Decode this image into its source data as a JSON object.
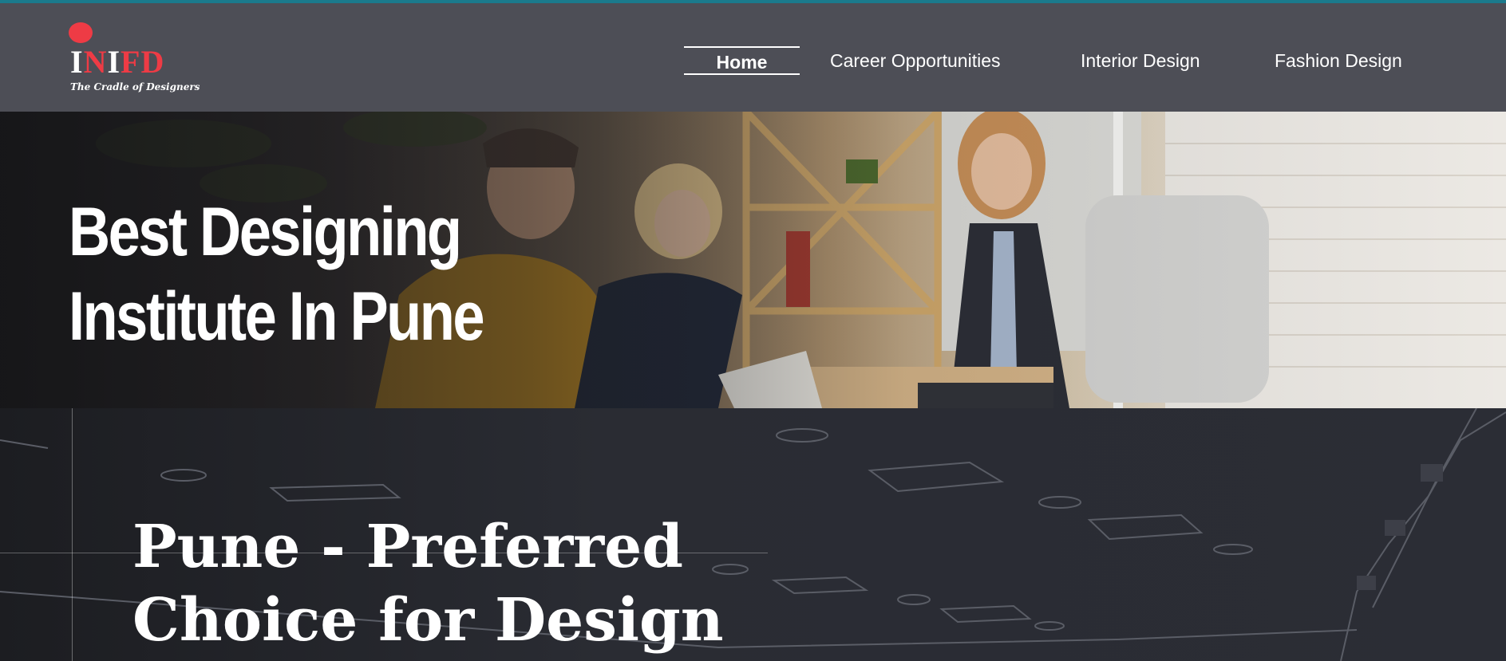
{
  "logo": {
    "word_white_1": "I",
    "word_red_1": "N",
    "word_white_2": "I",
    "word_red_2": "FD",
    "tagline": "The Cradle of Designers"
  },
  "nav": {
    "items": [
      {
        "label": "Home",
        "active": true
      },
      {
        "label": "Career Opportunities",
        "active": false
      },
      {
        "label": "Interior Design",
        "active": false
      },
      {
        "label": "Fashion Design",
        "active": false
      }
    ]
  },
  "hero": {
    "title_line1": "Best Designing",
    "title_line2": "Institute In Pune"
  },
  "section": {
    "title_line1": "Pune - Preferred",
    "title_line2": "Choice for Design"
  },
  "colors": {
    "accent_top": "#1b7a8c",
    "header_bg": "#4d4e56",
    "brand_red": "#ee3b45",
    "section_bg": "#2a2c33"
  }
}
